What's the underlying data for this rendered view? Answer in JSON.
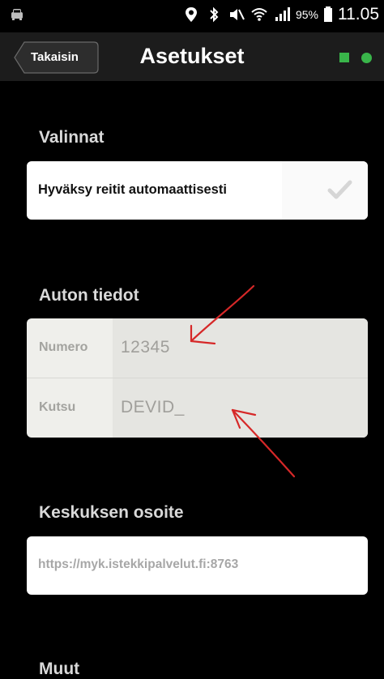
{
  "status_bar": {
    "battery_percent": "95%",
    "time": "11.05",
    "icons": [
      "car-icon",
      "location-icon",
      "bluetooth-icon",
      "mute-icon",
      "wifi-icon",
      "signal-icon",
      "battery-icon"
    ]
  },
  "header": {
    "back_label": "Takaisin",
    "title": "Asetukset",
    "indicator_color": "#39b54a"
  },
  "options": {
    "section_title": "Valinnat",
    "auto_accept_label": "Hyväksy reitit automaattisesti",
    "auto_accept_checked": false
  },
  "car_info": {
    "section_title": "Auton tiedot",
    "number_label": "Numero",
    "number_value": "12345",
    "call_label": "Kutsu",
    "call_value": "DEVID_"
  },
  "center_address": {
    "section_title": "Keskuksen osoite",
    "value": "https://myk.istekkipalvelut.fi:8763"
  },
  "other": {
    "section_title": "Muut"
  },
  "annotation_color": "#d62828"
}
